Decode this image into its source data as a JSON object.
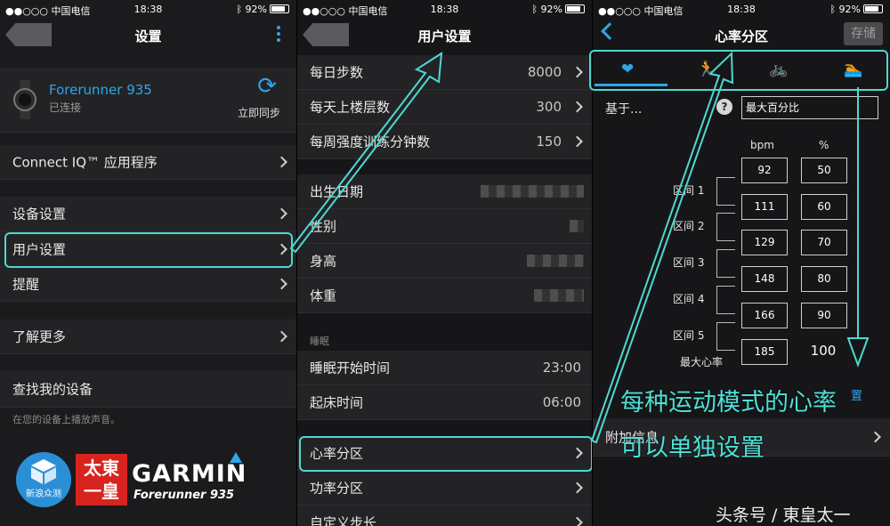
{
  "status": {
    "carrier": "●●○○○ 中国电信",
    "time": "18:38",
    "battery": "92%"
  },
  "screen1": {
    "title": "设置",
    "device_name": "Forerunner 935",
    "device_status": "已连接",
    "sync_label": "立即同步",
    "items": [
      "Connect IQ™ 应用程序",
      "设备设置",
      "用户设置",
      "提醒",
      "了解更多",
      "查找我的设备"
    ],
    "find_device_hint": "在您的设备上播放声音。"
  },
  "screen2": {
    "title": "用户设置",
    "goals": [
      {
        "label": "每日步数",
        "value": "8000"
      },
      {
        "label": "每天上楼层数",
        "value": "300"
      },
      {
        "label": "每周强度训练分钟数",
        "value": "150"
      }
    ],
    "profile": [
      "出生日期",
      "性别",
      "身高",
      "体重"
    ],
    "sleep_section": "睡眠",
    "sleep": [
      {
        "label": "睡眠开始时间",
        "value": "23:00"
      },
      {
        "label": "起床时间",
        "value": "06:00"
      }
    ],
    "zones": [
      "心率分区",
      "功率分区",
      "自定义步长"
    ]
  },
  "screen3": {
    "title": "心率分区",
    "save_label": "存储",
    "based_on_label": "基于...",
    "help_symbol": "?",
    "based_on_value": "最大百分比",
    "col_bpm": "bpm",
    "col_pct": "%",
    "bpm": [
      "92",
      "111",
      "129",
      "148",
      "166",
      "185"
    ],
    "pct": [
      "50",
      "60",
      "70",
      "80",
      "90",
      "100"
    ],
    "zone_labels": [
      "区间 1",
      "区间 2",
      "区间 3",
      "区间 4",
      "区间 5"
    ],
    "max_hr_label": "最大心率",
    "reset_partial": "置",
    "extra_info_label": "附加信息"
  },
  "annotation": {
    "line1": "每种运动模式的心率",
    "line2": "可以单独设置"
  },
  "watermark": {
    "brand": "GARMIN",
    "model": "Forerunner 935",
    "stamp": "太東一皇",
    "badge": "新浪众测",
    "source": "头条号 / 東皇太一"
  },
  "colors": {
    "accent": "#2ea6e9",
    "highlight": "#4ed8d0",
    "panel": "#1b1b1d"
  }
}
